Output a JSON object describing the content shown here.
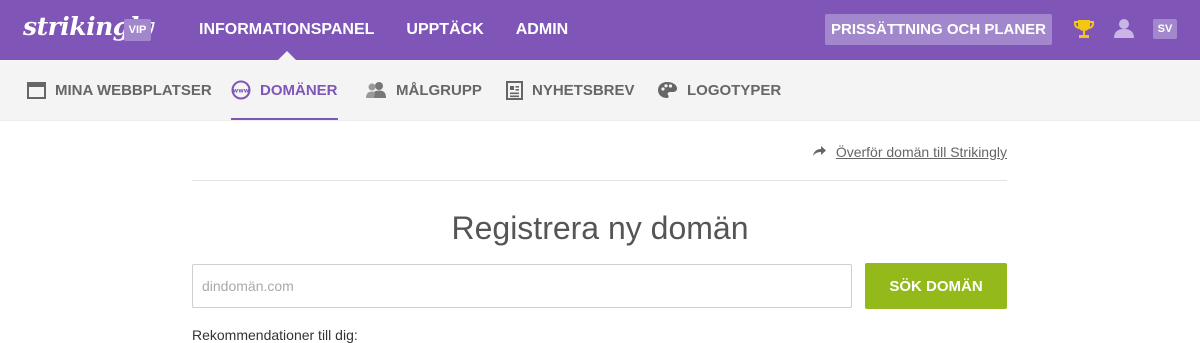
{
  "brand": {
    "logo": "strikingly",
    "badge": "VIP"
  },
  "main_nav": [
    {
      "label": "INFORMATIONSPANEL",
      "active": true
    },
    {
      "label": "UPPTÄCK",
      "active": false
    },
    {
      "label": "ADMIN",
      "active": false
    }
  ],
  "header": {
    "pricing_label": "PRISSÄTTNING OCH PLANER",
    "lang": "SV"
  },
  "sub_nav": [
    {
      "label": "MINA WEBBPLATSER",
      "icon": "browser-window-icon",
      "active": false
    },
    {
      "label": "DOMÄNER",
      "icon": "www-globe-icon",
      "active": true
    },
    {
      "label": "MÅLGRUPP",
      "icon": "people-icon",
      "active": false
    },
    {
      "label": "NYHETSBREV",
      "icon": "newsletter-icon",
      "active": false
    },
    {
      "label": "LOGOTYPER",
      "icon": "palette-icon",
      "active": false
    }
  ],
  "page": {
    "transfer_link": "Överför domän till Strikingly",
    "title": "Registrera ny domän",
    "search_placeholder": "dindomän.com",
    "search_button": "SÖK DOMÄN",
    "recommendations": "Rekommendationer till dig:"
  },
  "colors": {
    "brand_purple": "#7f56b8",
    "accent_green": "#93b91b",
    "nav_bg": "#f4f4f4"
  }
}
